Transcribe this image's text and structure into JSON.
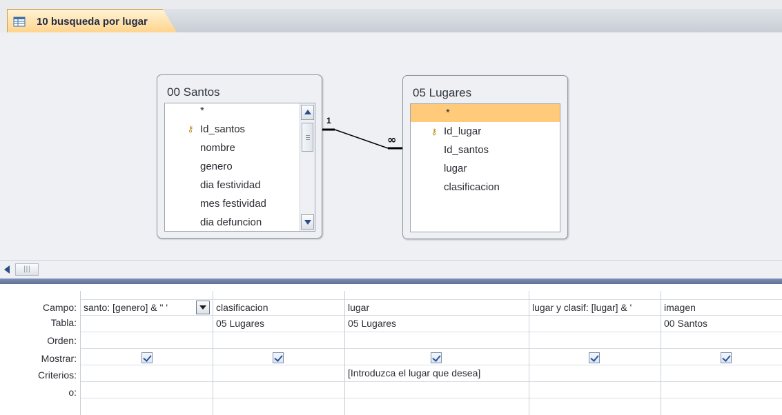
{
  "tab": {
    "title": "10 busqueda por lugar",
    "icon": "query-design-icon"
  },
  "tables": [
    {
      "name": "00 Santos",
      "fields": [
        "*",
        "Id_santos",
        "nombre",
        "genero",
        "dia festividad",
        "mes festividad",
        "dia defuncion"
      ],
      "key_field": "Id_santos"
    },
    {
      "name": "05 Lugares",
      "fields": [
        "*",
        "Id_lugar",
        "Id_santos",
        "lugar",
        "clasificacion"
      ],
      "key_field": "Id_lugar",
      "selected_field": "*"
    }
  ],
  "relationship": {
    "one_label": "1",
    "many_label": "∞"
  },
  "grid": {
    "row_labels": [
      "Campo:",
      "Tabla:",
      "Orden:",
      "Mostrar:",
      "Criterios:",
      "o:"
    ],
    "columns": [
      {
        "campo": "santo: [genero] & \" '",
        "tabla": "",
        "orden": "",
        "mostrar": true,
        "criterios": "",
        "o": "",
        "has_dropdown": true
      },
      {
        "campo": "clasificacion",
        "tabla": "05 Lugares",
        "orden": "",
        "mostrar": true,
        "criterios": "",
        "o": ""
      },
      {
        "campo": "lugar",
        "tabla": "05 Lugares",
        "orden": "",
        "mostrar": true,
        "criterios": "[Introduzca el lugar que desea]",
        "o": ""
      },
      {
        "campo": "lugar y clasif: [lugar] & '",
        "tabla": "",
        "orden": "",
        "mostrar": true,
        "criterios": "",
        "o": ""
      },
      {
        "campo": "imagen",
        "tabla": "00 Santos",
        "orden": "",
        "mostrar": true,
        "criterios": "",
        "o": ""
      }
    ]
  },
  "colors": {
    "tab_active": "#ffd38a",
    "selected_field": "#ffcb7a",
    "splitter": "#6b7ba3",
    "design_bg": "#eef0f3"
  }
}
